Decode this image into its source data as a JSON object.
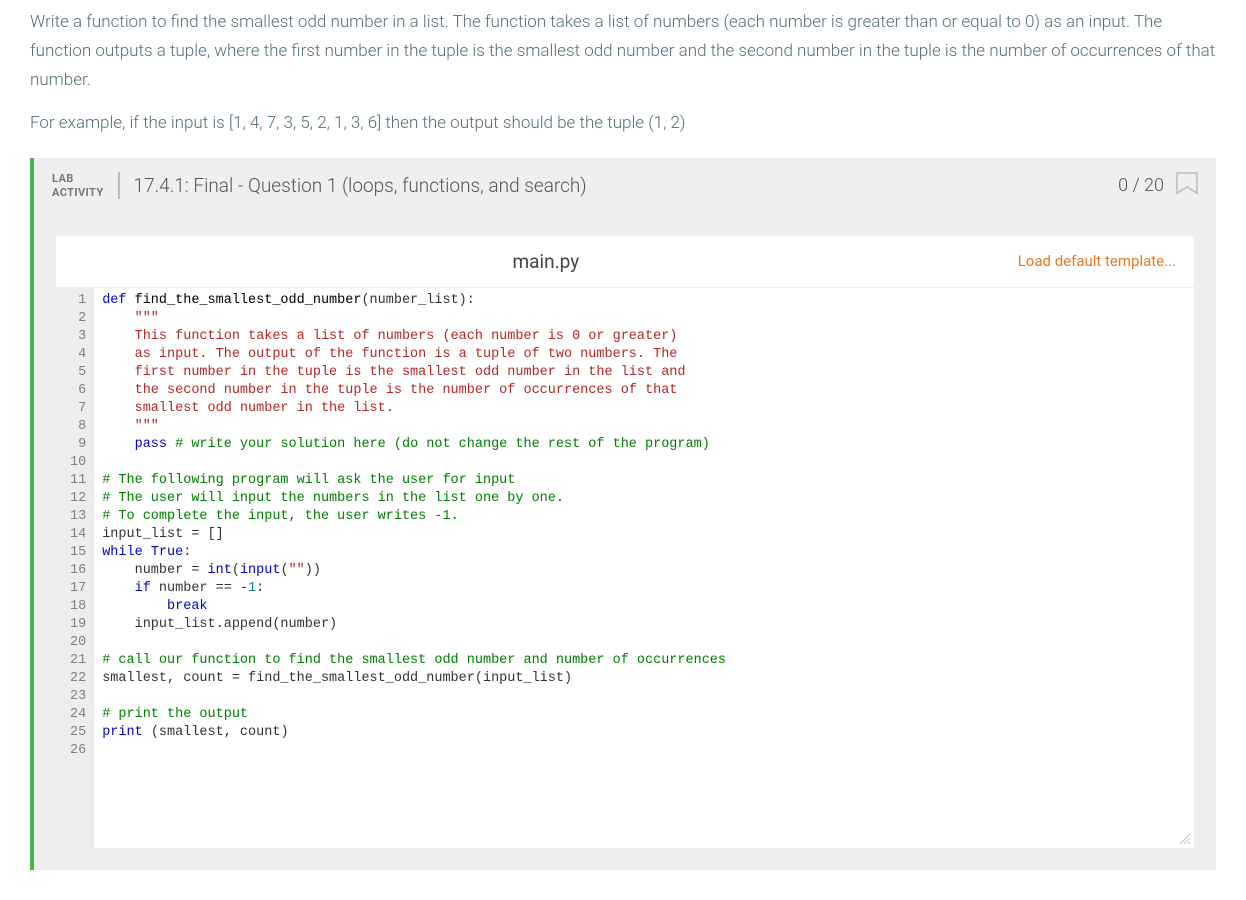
{
  "intro": {
    "p1": "Write a function to find the smallest odd number in a list. The function takes a list of numbers (each number is greater than or equal to 0) as an input. The function outputs a tuple, where the first number in the tuple is the smallest odd number and the second number in the tuple is the number of occurrences of that number.",
    "p2": "For example, if the input is [1, 4, 7, 3, 5, 2, 1, 3, 6] then the output should be the tuple (1, 2)"
  },
  "lab": {
    "label_line1": "LAB",
    "label_line2": "ACTIVITY",
    "title": "17.4.1: Final - Question 1 (loops, functions, and search)",
    "score": "0 / 20"
  },
  "editor": {
    "filename": "main.py",
    "load_template_label": "Load default template...",
    "line_count": 26,
    "code_lines": [
      {
        "n": 1,
        "tokens": [
          {
            "t": "def ",
            "c": "kw"
          },
          {
            "t": "find_the_smallest_odd_number",
            "c": "def"
          },
          {
            "t": "(number_list):",
            "c": ""
          }
        ]
      },
      {
        "n": 2,
        "tokens": [
          {
            "t": "    ",
            "c": ""
          },
          {
            "t": "\"\"\"",
            "c": "str"
          }
        ]
      },
      {
        "n": 3,
        "tokens": [
          {
            "t": "    ",
            "c": ""
          },
          {
            "t": "This function takes a list of numbers (each number is 0 or greater)",
            "c": "str"
          }
        ]
      },
      {
        "n": 4,
        "tokens": [
          {
            "t": "    ",
            "c": ""
          },
          {
            "t": "as input. The output of the function is a tuple of two numbers. The",
            "c": "str"
          }
        ]
      },
      {
        "n": 5,
        "tokens": [
          {
            "t": "    ",
            "c": ""
          },
          {
            "t": "first number in the tuple is the smallest odd number in the list and",
            "c": "str"
          }
        ]
      },
      {
        "n": 6,
        "tokens": [
          {
            "t": "    ",
            "c": ""
          },
          {
            "t": "the second number in the tuple is the number of occurrences of that",
            "c": "str"
          }
        ]
      },
      {
        "n": 7,
        "tokens": [
          {
            "t": "    ",
            "c": ""
          },
          {
            "t": "smallest odd number in the list.",
            "c": "str"
          }
        ]
      },
      {
        "n": 8,
        "tokens": [
          {
            "t": "    ",
            "c": ""
          },
          {
            "t": "\"\"\"",
            "c": "str"
          }
        ]
      },
      {
        "n": 9,
        "tokens": [
          {
            "t": "    ",
            "c": ""
          },
          {
            "t": "pass",
            "c": "kw"
          },
          {
            "t": " ",
            "c": ""
          },
          {
            "t": "# write your solution here (do not change the rest of the program)",
            "c": "com"
          }
        ]
      },
      {
        "n": 10,
        "tokens": [
          {
            "t": "",
            "c": ""
          }
        ]
      },
      {
        "n": 11,
        "tokens": [
          {
            "t": "# The following program will ask the user for input",
            "c": "com"
          }
        ]
      },
      {
        "n": 12,
        "tokens": [
          {
            "t": "# The user will input the numbers in the list one by one.",
            "c": "com"
          }
        ]
      },
      {
        "n": 13,
        "tokens": [
          {
            "t": "# To complete the input, the user writes -1.",
            "c": "com"
          }
        ]
      },
      {
        "n": 14,
        "tokens": [
          {
            "t": "input_list = []",
            "c": ""
          }
        ]
      },
      {
        "n": 15,
        "tokens": [
          {
            "t": "while ",
            "c": "kw"
          },
          {
            "t": "True",
            "c": "kw"
          },
          {
            "t": ":",
            "c": ""
          }
        ]
      },
      {
        "n": 16,
        "tokens": [
          {
            "t": "    number = ",
            "c": ""
          },
          {
            "t": "int",
            "c": "builtin"
          },
          {
            "t": "(",
            "c": ""
          },
          {
            "t": "input",
            "c": "builtin"
          },
          {
            "t": "(",
            "c": ""
          },
          {
            "t": "\"\"",
            "c": "str"
          },
          {
            "t": "))",
            "c": ""
          }
        ]
      },
      {
        "n": 17,
        "tokens": [
          {
            "t": "    ",
            "c": ""
          },
          {
            "t": "if",
            "c": "kw"
          },
          {
            "t": " number == -",
            "c": ""
          },
          {
            "t": "1",
            "c": "num"
          },
          {
            "t": ":",
            "c": ""
          }
        ]
      },
      {
        "n": 18,
        "tokens": [
          {
            "t": "        ",
            "c": ""
          },
          {
            "t": "break",
            "c": "kw"
          }
        ]
      },
      {
        "n": 19,
        "tokens": [
          {
            "t": "    input_list.append(number)",
            "c": ""
          }
        ]
      },
      {
        "n": 20,
        "tokens": [
          {
            "t": "",
            "c": ""
          }
        ]
      },
      {
        "n": 21,
        "tokens": [
          {
            "t": "# call our function to find the smallest odd number and number of occurrences",
            "c": "com"
          }
        ]
      },
      {
        "n": 22,
        "tokens": [
          {
            "t": "smallest, count = find_the_smallest_odd_number(input_list)",
            "c": ""
          }
        ]
      },
      {
        "n": 23,
        "tokens": [
          {
            "t": "",
            "c": ""
          }
        ]
      },
      {
        "n": 24,
        "tokens": [
          {
            "t": "# print the output",
            "c": "com"
          }
        ]
      },
      {
        "n": 25,
        "tokens": [
          {
            "t": "print",
            "c": "builtin"
          },
          {
            "t": " (smallest, count)",
            "c": ""
          }
        ]
      },
      {
        "n": 26,
        "tokens": [
          {
            "t": "",
            "c": ""
          }
        ],
        "hl": true
      }
    ]
  }
}
